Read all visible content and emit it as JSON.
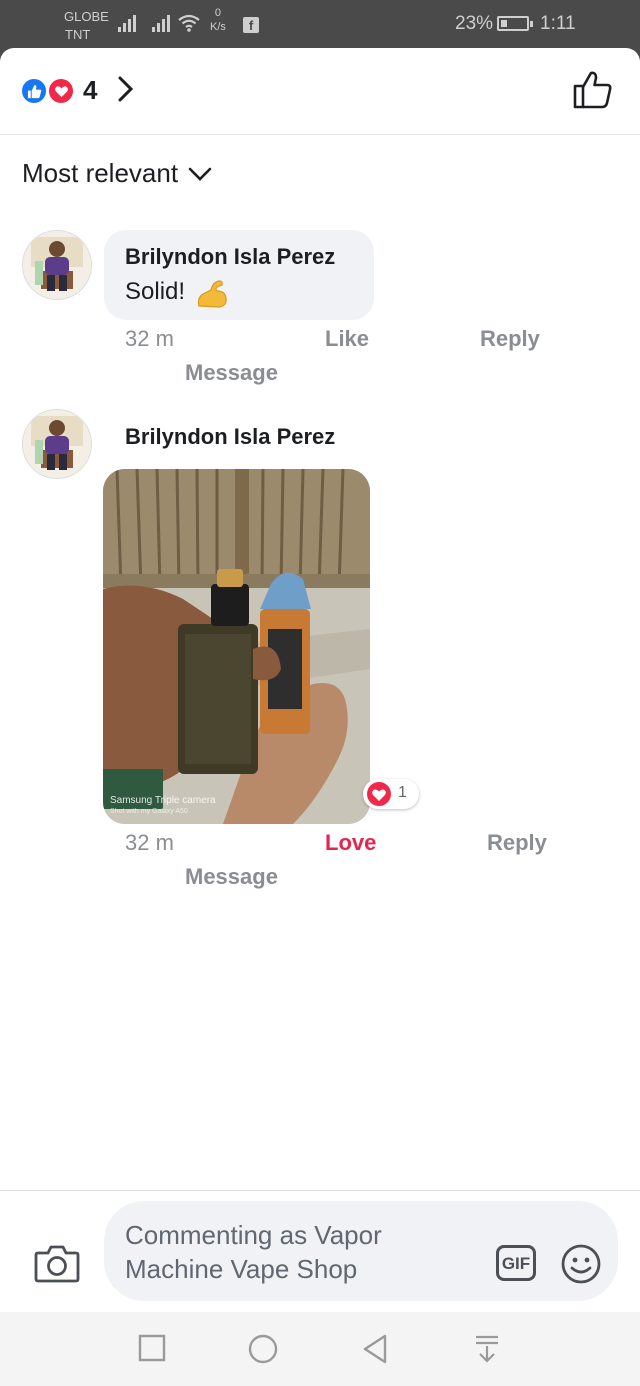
{
  "status_bar": {
    "carrier_1": "GLOBE",
    "carrier_2": "TNT",
    "net_speed_value": "0",
    "net_speed_unit": "K/s",
    "notification": "f",
    "battery_percent": "23%",
    "battery_level": 0.23,
    "time": "1:11"
  },
  "reactions_bar": {
    "icons": [
      "like-icon",
      "love-icon"
    ],
    "count": "4",
    "like_color": "#1877f2",
    "love_color": "#f02849"
  },
  "sort": {
    "label": "Most relevant"
  },
  "comments": [
    {
      "author": "Brilyndon Isla Perez",
      "text": "Solid!",
      "emoji": "flexed-biceps-emoji",
      "time": "32 m",
      "like_label": "Like",
      "reply_label": "Reply",
      "message_label": "Message"
    },
    {
      "author": "Brilyndon Isla Perez",
      "image": "photo-of-vape-mod-and-e-liquid-bottle",
      "photo_watermark_1": "Samsung Triple camera",
      "photo_watermark_2": "Shot with my Galaxy A50",
      "reaction_count": "1",
      "time": "32 m",
      "like_label": "Love",
      "reply_label": "Reply",
      "message_label": "Message"
    }
  ],
  "composer": {
    "placeholder": "Commenting as Vapor Machine Vape Shop",
    "gif_label": "GIF"
  },
  "colors": {
    "accent_blue": "#1877f2",
    "love_red": "#e4264f",
    "meta_gray": "#8a8d91",
    "bubble_gray": "#f0f2f5"
  }
}
